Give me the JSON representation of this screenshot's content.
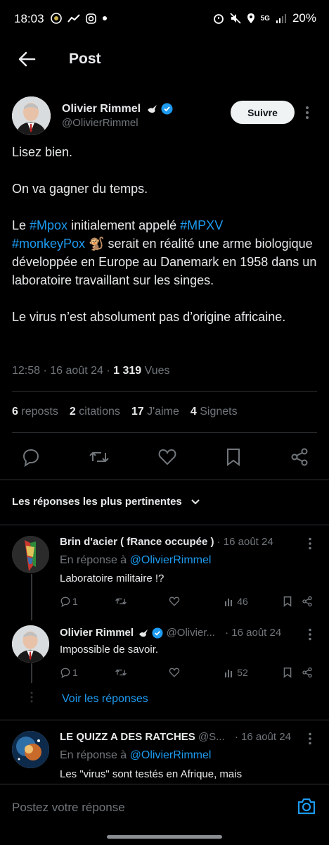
{
  "status_bar": {
    "time": "18:03",
    "network": "5G",
    "battery": "20%"
  },
  "header": {
    "title": "Post"
  },
  "post": {
    "author_name": "Olivier Rimmel",
    "author_handle": "@OlivierRimmel",
    "follow_label": "Suivre",
    "text_line1": "Lisez bien.",
    "text_line2": "On va gagner du temps.",
    "text_p3_a": "Le ",
    "text_p3_tag1": "#Mpox",
    "text_p3_b": " initialement appelé ",
    "text_p3_tag2": "#MPXV",
    "text_p3_tag3": "#monkeyPox",
    "text_p3_emoji": "🐒",
    "text_p3_c": " serait en réalité une arme biologique développée en Europe au Danemark en 1958 dans un laboratoire travaillant sur les singes.",
    "text_p4": "Le virus n’est absolument pas d’origine africaine.",
    "time": "12:58",
    "date": "16 août 24",
    "views_count": "1 319",
    "views_label": "Vues",
    "reposts_count": "6",
    "reposts_label": "reposts",
    "quotes_count": "2",
    "quotes_label": "citations",
    "likes_count": "17",
    "likes_label": "J'aime",
    "bookmarks_count": "4",
    "bookmarks_label": "Signets"
  },
  "replies_sort": "Les réponses les plus pertinentes",
  "replies": [
    {
      "name": "Brin d'acier ( fRance occupée )",
      "date": "· 16 août 24",
      "in_reply_prefix": "En réponse à",
      "in_reply_handle": "@OlivierRimmel",
      "text": "Laboratoire militaire !?",
      "reply_count": "1",
      "views": "46"
    },
    {
      "name": "Olivier Rimmel",
      "handle": "@Olivier...",
      "date": "· 16 août 24",
      "text": "Impossible de savoir.",
      "reply_count": "1",
      "views": "52"
    },
    {
      "name": "LE QUIZZ A DES RATCHES",
      "handle": "@S...",
      "date": "· 16 août 24",
      "in_reply_prefix": "En réponse à",
      "in_reply_handle": "@OlivierRimmel",
      "text": "Les \"virus\" sont testés en Afrique, mais"
    }
  ],
  "view_replies_label": "Voir les réponses",
  "compose": {
    "placeholder": "Postez votre réponse"
  },
  "colors": {
    "accent": "#1d9bf0",
    "background": "#000000",
    "muted": "#71767b"
  }
}
